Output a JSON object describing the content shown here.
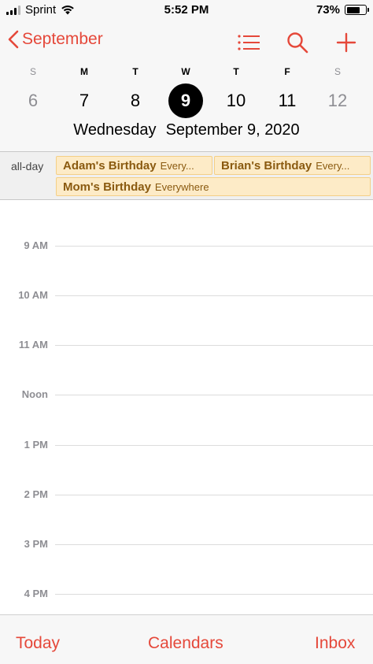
{
  "status_bar": {
    "carrier": "Sprint",
    "time": "5:52 PM",
    "battery_percent": "73%",
    "battery_level": 0.73,
    "icons": [
      "signal-icon",
      "wifi-icon",
      "battery-icon"
    ]
  },
  "header": {
    "back_label": "September",
    "icons": [
      "list-icon",
      "search-icon",
      "plus-icon"
    ],
    "accent_color": "#e5483a"
  },
  "week": {
    "weekdays": [
      "S",
      "M",
      "T",
      "W",
      "T",
      "F",
      "S"
    ],
    "dates": [
      "6",
      "7",
      "8",
      "9",
      "10",
      "11",
      "12"
    ],
    "selected_index": 3
  },
  "date_title": {
    "weekday": "Wednesday",
    "date": "September 9, 2020"
  },
  "all_day": {
    "label": "all-day",
    "events": [
      {
        "title": "Adam's Birthday",
        "location": "Every..."
      },
      {
        "title": "Brian's Birthday",
        "location": "Every..."
      },
      {
        "title": "Mom's Birthday",
        "location": "Everywhere"
      }
    ],
    "event_color": "#fdebc7"
  },
  "timeline": {
    "hours": [
      "9 AM",
      "10 AM",
      "11 AM",
      "Noon",
      "1 PM",
      "2 PM",
      "3 PM",
      "4 PM"
    ]
  },
  "tabbar": {
    "today": "Today",
    "calendars": "Calendars",
    "inbox": "Inbox"
  }
}
